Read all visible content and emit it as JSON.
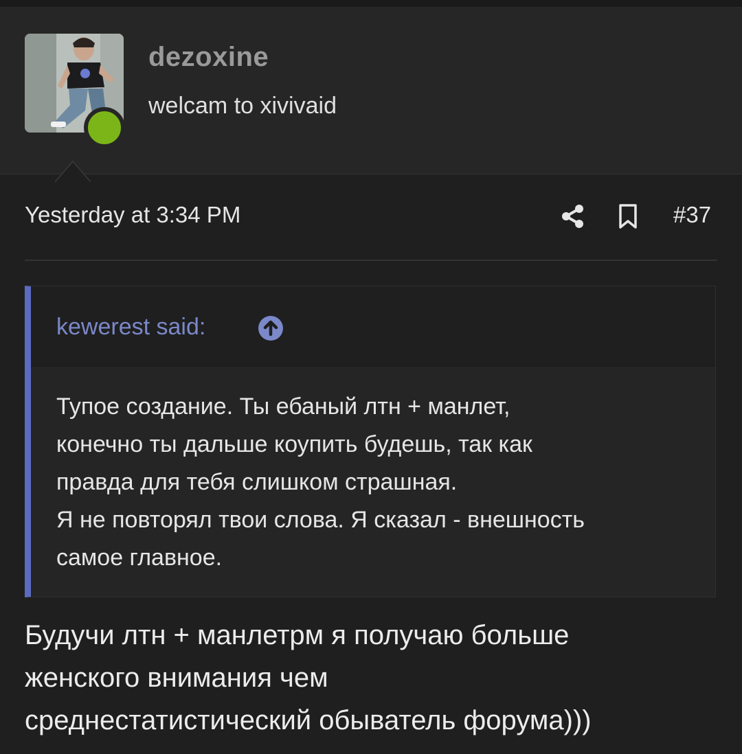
{
  "user": {
    "name": "dezoxine",
    "title": "welcam to xivivaid",
    "online_color": "#7cb518"
  },
  "post": {
    "date": "Yesterday at 3:34 PM",
    "number": "#37",
    "share_icon": "share-icon",
    "bookmark_icon": "bookmark-icon"
  },
  "quote": {
    "author": "kewerest said:",
    "jump_icon": "arrow-up-circle-icon",
    "lines": [
      "Тупое создание. Ты ебаный лтн + манлет,",
      "конечно ты дальше коупить будешь, так как",
      "правда для тебя слишком страшная.",
      "Я не повторял твои слова. Я сказал - внешность",
      "самое главное."
    ]
  },
  "body": {
    "lines": [
      "Будучи лтн + манлетрм я получаю больше",
      "женского внимания чем",
      "среднестатистический обыватель форума)))"
    ]
  },
  "colors": {
    "background": "#1f1f1f",
    "accent": "#5c6bc0",
    "quote_author": "#7b88c9"
  }
}
